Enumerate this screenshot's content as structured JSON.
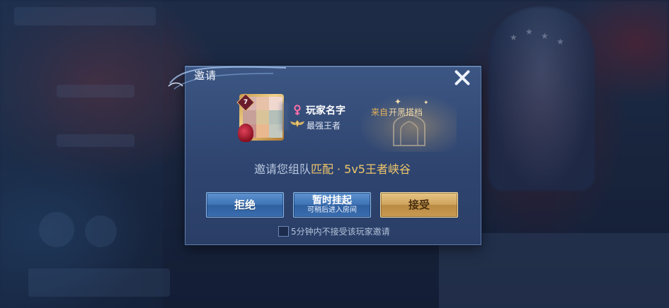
{
  "dialog": {
    "title": "邀请",
    "player": {
      "level_badge": "7",
      "name": "玩家名字",
      "gender_icon": "female-icon",
      "rank_icon": "rank-wings-icon",
      "rank": "最强王者"
    },
    "from": {
      "prefix": "来自",
      "name": "开黑搭档"
    },
    "invite": {
      "text": "邀请您组队",
      "mode": "匹配",
      "separator": "·",
      "map": "5v5王者峡谷"
    },
    "buttons": {
      "reject": "拒绝",
      "hold": "暂时挂起",
      "hold_sub": "可稍后进入房间",
      "accept": "接受"
    },
    "checkbox": {
      "label": "5分钟内不接受该玩家邀请",
      "checked": false
    }
  },
  "colors": {
    "dialog_bg": "#2f4570",
    "highlight": "#f0c66a",
    "from_label": "#e4b25a",
    "button_blue": "#3f74b6",
    "button_gold": "#cfa45d"
  }
}
